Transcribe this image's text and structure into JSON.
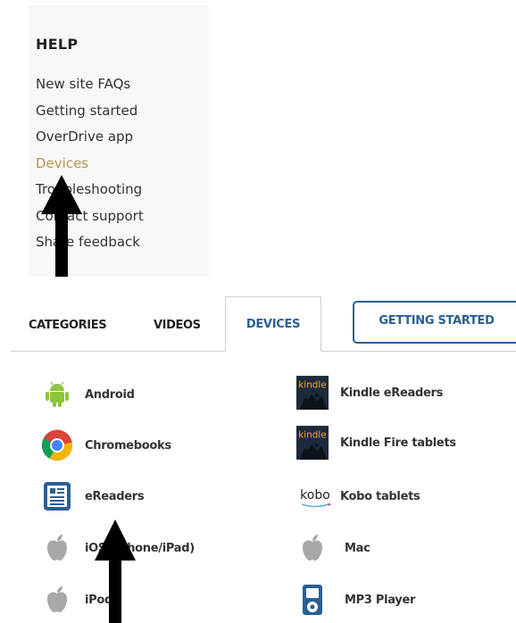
{
  "help": {
    "title": "HELP",
    "links": [
      {
        "label": "New site FAQs",
        "active": false
      },
      {
        "label": "Getting started",
        "active": false
      },
      {
        "label": "OverDrive app",
        "active": false
      },
      {
        "label": "Devices",
        "active": true
      },
      {
        "label": "Troubleshooting",
        "active": false
      },
      {
        "label": "Contact support",
        "active": false
      },
      {
        "label": "Share feedback",
        "active": false
      }
    ]
  },
  "tabs": {
    "categories": "CATEGORIES",
    "videos": "VIDEOS",
    "devices": "DEVICES",
    "getting_started": "GETTING STARTED",
    "active": "DEVICES"
  },
  "devices": {
    "left": [
      {
        "label": "Android",
        "icon": "android-icon"
      },
      {
        "label": "Chromebooks",
        "icon": "chrome-icon"
      },
      {
        "label": "eReaders",
        "icon": "ereader-icon"
      },
      {
        "label": "iOS (iPhone/iPad)",
        "icon": "apple-icon"
      },
      {
        "label": "iPod",
        "icon": "apple-icon"
      }
    ],
    "right": [
      {
        "label": "Kindle eReaders",
        "icon": "kindle-icon"
      },
      {
        "label": "Kindle Fire tablets",
        "icon": "kindle-icon"
      },
      {
        "label": "Kobo tablets",
        "icon": "kobo-icon"
      },
      {
        "label": "Mac",
        "icon": "apple-icon"
      },
      {
        "label": "MP3 Player",
        "icon": "mp3-player-icon"
      }
    ]
  },
  "kobo_logo_text": "kobo",
  "kindle_logo_text": "kindle",
  "colors": {
    "accent_blue": "#2a5f93",
    "active_gold": "#b8944f",
    "android_green": "#8cc63f",
    "apple_gray": "#a8a8a8"
  }
}
